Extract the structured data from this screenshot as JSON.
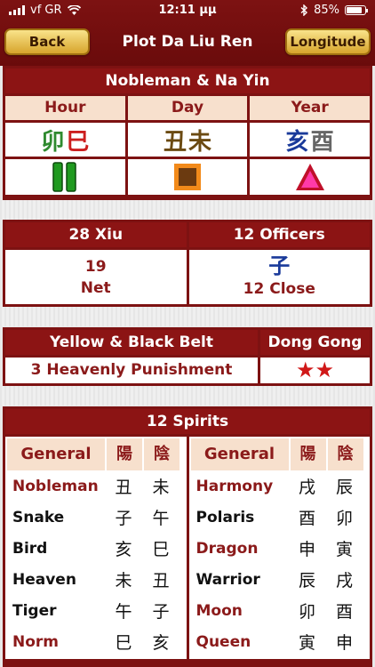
{
  "status": {
    "carrier": "vf GR",
    "time": "12:11 μμ",
    "battery": "85%"
  },
  "nav": {
    "back": "Back",
    "title": "Plot Da Liu Ren",
    "longitude": "Longitude"
  },
  "nobleman": {
    "title": "Nobleman & Na Yin",
    "headers": [
      "Hour",
      "Day",
      "Year"
    ],
    "hour_chars": [
      {
        "ch": "卯",
        "color": "#2f8a2f"
      },
      {
        "ch": "巳",
        "color": "#cc1e1e"
      }
    ],
    "day_chars": [
      {
        "ch": "丑",
        "color": "#6b4a12"
      },
      {
        "ch": "未",
        "color": "#6b4a12"
      }
    ],
    "year_chars": [
      {
        "ch": "亥",
        "color": "#1a3a9a"
      },
      {
        "ch": "酉",
        "color": "#666666"
      }
    ],
    "symbols": [
      "wood-bars-icon",
      "earth-square-icon",
      "fire-triangle-icon"
    ]
  },
  "xiu": {
    "title": "28 Xiu",
    "number": "19",
    "name": "Net"
  },
  "officers": {
    "title": "12 Officers",
    "char": "子",
    "label": "12 Close"
  },
  "belt": {
    "title": "Yellow & Black Belt",
    "value": "3 Heavenly Punishment"
  },
  "donggong": {
    "title": "Dong Gong",
    "stars": "★★"
  },
  "spirits": {
    "title": "12 Spirits",
    "col_general": "General",
    "col_yang": "陽",
    "col_yin": "陰",
    "left": [
      {
        "name": "Nobleman",
        "yang": "丑",
        "yin": "未",
        "color": "#8b1a1a"
      },
      {
        "name": "Snake",
        "yang": "子",
        "yin": "午",
        "color": "#111111"
      },
      {
        "name": "Bird",
        "yang": "亥",
        "yin": "巳",
        "color": "#111111"
      },
      {
        "name": "Heaven",
        "yang": "未",
        "yin": "丑",
        "color": "#111111"
      },
      {
        "name": "Tiger",
        "yang": "午",
        "yin": "子",
        "color": "#111111"
      },
      {
        "name": "Norm",
        "yang": "巳",
        "yin": "亥",
        "color": "#8b1a1a"
      }
    ],
    "right": [
      {
        "name": "Harmony",
        "yang": "戌",
        "yin": "辰",
        "color": "#8b1a1a"
      },
      {
        "name": "Polaris",
        "yang": "酉",
        "yin": "卯",
        "color": "#111111"
      },
      {
        "name": "Dragon",
        "yang": "申",
        "yin": "寅",
        "color": "#8b1a1a"
      },
      {
        "name": "Warrior",
        "yang": "辰",
        "yin": "戌",
        "color": "#111111"
      },
      {
        "name": "Moon",
        "yang": "卯",
        "yin": "酉",
        "color": "#8b1a1a"
      },
      {
        "name": "Queen",
        "yang": "寅",
        "yin": "申",
        "color": "#8b1a1a"
      }
    ]
  }
}
